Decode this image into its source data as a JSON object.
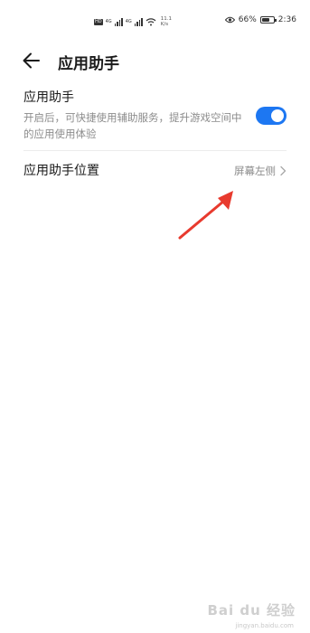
{
  "status_bar": {
    "hd_label": "HD",
    "net_label_1": "4G",
    "net_label_2": "4G",
    "speed_value": "11.1",
    "speed_unit": "K/s",
    "battery_percent": "66%",
    "battery_level": 0.66,
    "time": "2:36"
  },
  "header": {
    "title": "应用助手"
  },
  "settings": {
    "helper": {
      "title": "应用助手",
      "description": "开启后，可快捷使用辅助服务，提升游戏空间中的应用使用体验",
      "enabled": true
    },
    "position": {
      "title": "应用助手位置",
      "value": "屏幕左侧"
    }
  },
  "colors": {
    "accent": "#1d77f2",
    "annotation": "#e83a2e"
  },
  "watermark": {
    "text": "Bai du 经验",
    "url": "jingyan.baidu.com"
  }
}
